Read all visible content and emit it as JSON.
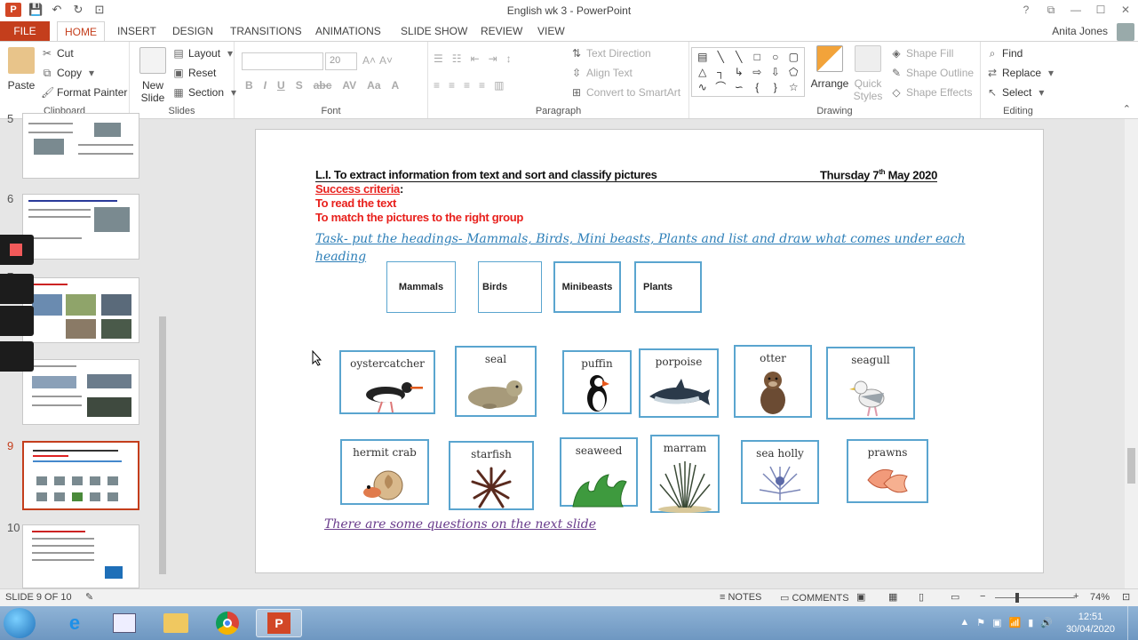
{
  "window": {
    "title": "English wk 3 - PowerPoint",
    "controls": [
      "?",
      "⧉",
      "—",
      "☐",
      "✕"
    ]
  },
  "tabs": {
    "file": "FILE",
    "items": [
      "HOME",
      "INSERT",
      "DESIGN",
      "TRANSITIONS",
      "ANIMATIONS",
      "SLIDE SHOW",
      "REVIEW",
      "VIEW"
    ],
    "active": "HOME",
    "user": "Anita Jones"
  },
  "ribbon": {
    "clipboard": {
      "paste": "Paste",
      "cut": "Cut",
      "copy": "Copy",
      "format_painter": "Format Painter",
      "label": "Clipboard"
    },
    "slides": {
      "new_slide": "New Slide",
      "layout": "Layout",
      "reset": "Reset",
      "section": "Section",
      "label": "Slides"
    },
    "font": {
      "font_size": "20",
      "label": "Font"
    },
    "paragraph": {
      "text_direction": "Text Direction",
      "align_text": "Align Text",
      "convert_smartart": "Convert to SmartArt",
      "label": "Paragraph"
    },
    "drawing": {
      "arrange": "Arrange",
      "quick_styles": "Quick Styles",
      "shape_fill": "Shape Fill",
      "shape_outline": "Shape Outline",
      "shape_effects": "Shape Effects",
      "label": "Drawing"
    },
    "editing": {
      "find": "Find",
      "replace": "Replace",
      "select": "Select",
      "label": "Editing"
    }
  },
  "thumbnails": {
    "numbers": [
      "5",
      "6",
      "7",
      "8",
      "9",
      "10"
    ],
    "active_index": 4
  },
  "slide": {
    "li_text": "L.I. To extract information from text and sort and classify pictures",
    "date_day": "Thursday 7",
    "date_sup": "th",
    "date_rest": " May 2020",
    "success_label": "Success criteria",
    "success_colon": ":",
    "criteria": [
      "To read the text",
      "To match the pictures to the right group"
    ],
    "task": "Task- put the headings- Mammals, Birds, Mini beasts, Plants and list and draw what comes under each heading",
    "headings": [
      "Mammals",
      "Birds",
      "Minibeasts",
      "Plants"
    ],
    "row1": [
      "oystercatcher",
      "seal",
      "puffin",
      "porpoise",
      "otter",
      "seagull"
    ],
    "row2": [
      "hermit crab",
      "starfish",
      "seaweed",
      "marram",
      "sea holly",
      "prawns"
    ],
    "note": "There are some questions on the next slide"
  },
  "statusbar": {
    "slide_count": "SLIDE 9 OF 10",
    "notes": "NOTES",
    "comments": "COMMENTS",
    "zoom": "74%"
  },
  "taskbar": {
    "time": "12:51",
    "date": "30/04/2020"
  },
  "colors": {
    "accent": "#c43e1c",
    "card_border": "#5aa5cf",
    "task_blue": "#2d7fb8",
    "criteria_red": "#e8201c",
    "note_purple": "#6a3c8c"
  }
}
